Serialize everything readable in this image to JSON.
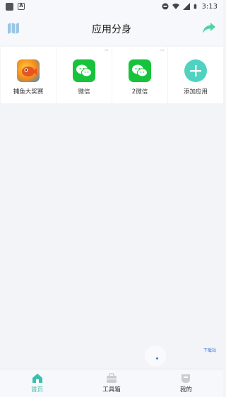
{
  "status_bar": {
    "time": "3:13",
    "notif_badge": "A"
  },
  "header": {
    "title": "应用分身"
  },
  "apps": [
    {
      "label": "捕鱼大奖赛",
      "icon": "fish-game-icon",
      "has_menu": false
    },
    {
      "label": "微信",
      "icon": "wechat-icon",
      "has_menu": true
    },
    {
      "label": "2微信",
      "icon": "wechat-icon",
      "has_menu": true
    },
    {
      "label": "添加应用",
      "icon": "plus-icon",
      "has_menu": false
    }
  ],
  "ad": {
    "link_label": "下载站"
  },
  "tabs": [
    {
      "label": "首页",
      "icon": "home-icon",
      "active": true
    },
    {
      "label": "工具箱",
      "icon": "toolbox-icon",
      "active": false
    },
    {
      "label": "我的",
      "icon": "profile-icon",
      "active": false
    }
  ],
  "colors": {
    "accent": "#3bbfae",
    "wechat": "#17c33b",
    "add": "#4fd3c0"
  }
}
